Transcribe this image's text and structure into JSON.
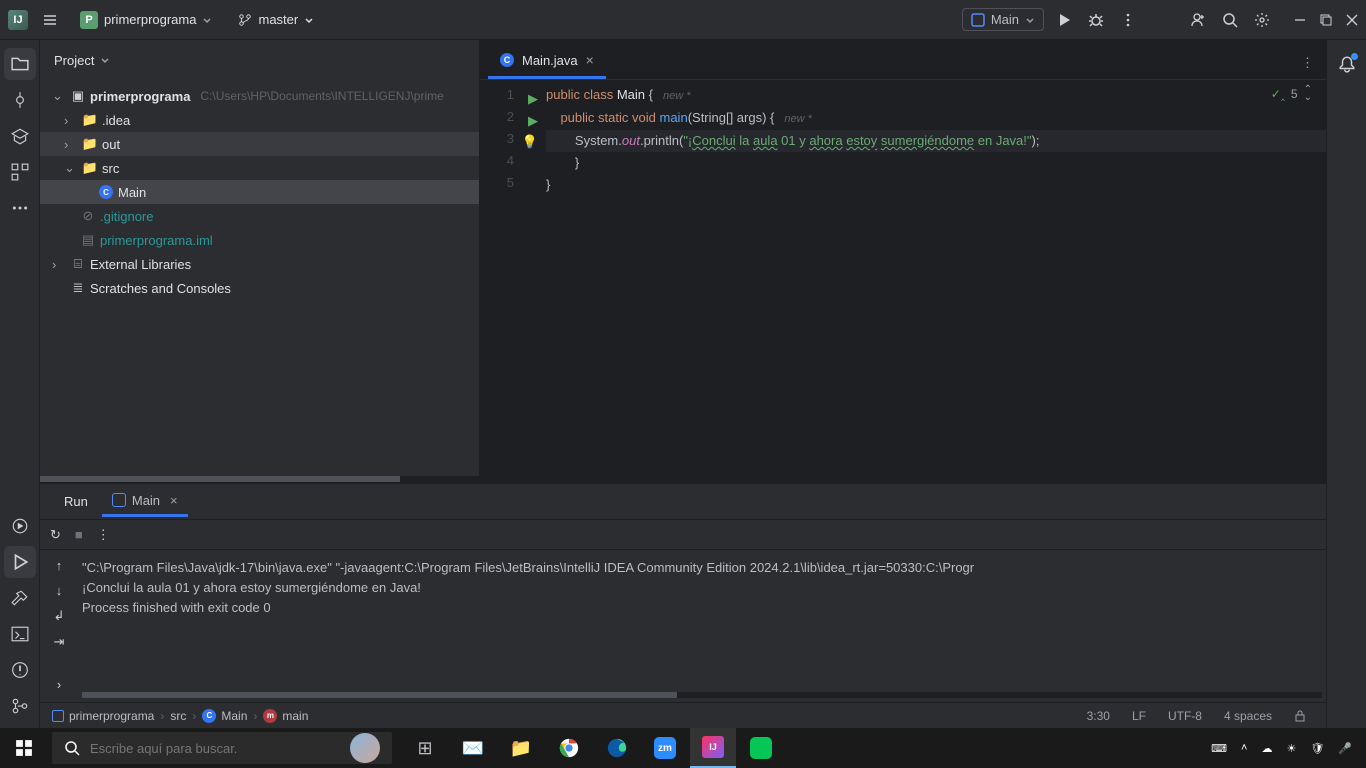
{
  "titlebar": {
    "project": "primerprograma",
    "project_badge": "P",
    "branch": "master",
    "run_config": "Main"
  },
  "project_panel": {
    "title": "Project",
    "root_label": "primerprograma",
    "root_path": "C:\\Users\\HP\\Documents\\INTELLIGENJ\\prime",
    "idea_folder": ".idea",
    "out_folder": "out",
    "src_folder": "src",
    "main_file": "Main",
    "gitignore": ".gitignore",
    "iml": "primerprograma.iml",
    "ext_lib": "External Libraries",
    "scratches": "Scratches and Consoles"
  },
  "editor": {
    "tab": "Main.java",
    "hint_new": "new *",
    "problems_count": "5",
    "code": {
      "l1_public": "public",
      "l1_class": "class",
      "l1_main": "Main",
      "l1_brace": " {",
      "l2_public": "public",
      "l2_static": "static",
      "l2_void": "void",
      "l2_main": "main",
      "l2_args": "(String[] args) {",
      "l3_sys": "System.",
      "l3_out": "out",
      "l3_println": ".println(",
      "l3_s1": "\"¡",
      "l3_t1": "Conclui",
      "l3_s2": " la ",
      "l3_t2": "aula",
      "l3_s3": " 01 y ",
      "l3_t3": "ahora",
      "l3_s4": " ",
      "l3_t4": "estoy",
      "l3_s5": " ",
      "l3_t5": "sumergiéndome",
      "l3_s6": " en Java!\"",
      "l3_end": ");",
      "l4": "        }",
      "l5": "}"
    }
  },
  "run": {
    "tab_run": "Run",
    "tab_main": "Main",
    "out_l1": "\"C:\\Program Files\\Java\\jdk-17\\bin\\java.exe\" \"-javaagent:C:\\Program Files\\JetBrains\\IntelliJ IDEA Community Edition 2024.2.1\\lib\\idea_rt.jar=50330:C:\\Progr",
    "out_l2": "¡Conclui la aula 01 y ahora estoy sumergiéndome en Java!",
    "out_l3": "",
    "out_l4": "Process finished with exit code 0"
  },
  "breadcrumb": {
    "b1": "primerprograma",
    "b2": "src",
    "b3": "Main",
    "b4": "main"
  },
  "status": {
    "pos": "3:30",
    "sep": "LF",
    "enc": "UTF-8",
    "indent": "4 spaces"
  },
  "taskbar": {
    "search_placeholder": "Escribe aquí para buscar.",
    "time": "",
    "date": ""
  }
}
